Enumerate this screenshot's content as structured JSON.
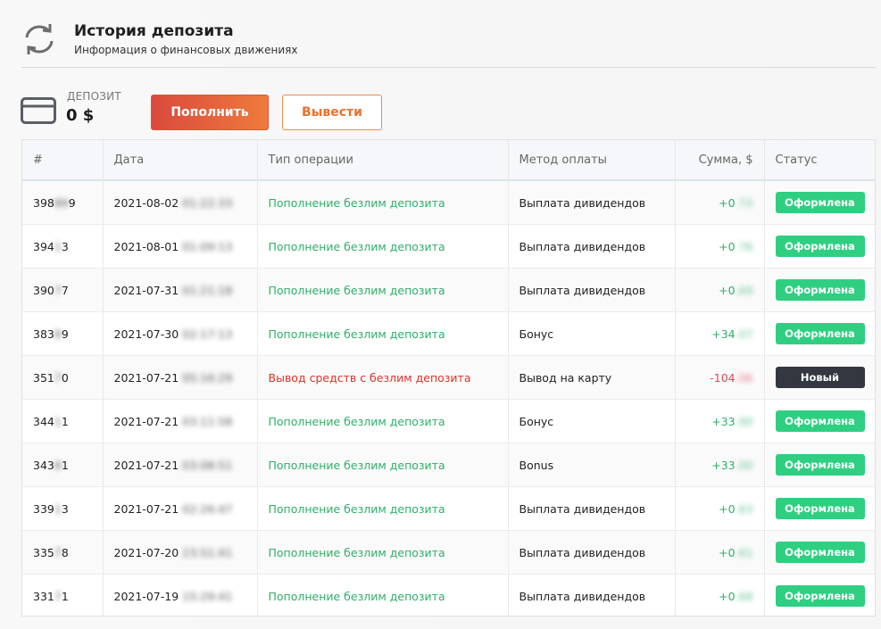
{
  "header": {
    "icon": "refresh-icon",
    "title": "История депозита",
    "subtitle": "Информация о финансовых движениях"
  },
  "deposit": {
    "icon": "credit-card-icon",
    "label": "ДЕПОЗИТ",
    "amount": "0 $",
    "topup_label": "Пополнить",
    "withdraw_label": "Вывести"
  },
  "colors": {
    "accent_gradient_start": "#d94a3d",
    "accent_gradient_end": "#ee7a3c",
    "positive": "#2eaf6a",
    "negative": "#d9342b",
    "badge_done": "#2fcf82",
    "badge_new": "#333840"
  },
  "table": {
    "columns": [
      "#",
      "Дата",
      "Тип операции",
      "Метод оплаты",
      "Сумма, $",
      "Статус"
    ],
    "rows": [
      {
        "id_a": "398",
        "id_b": "89",
        "id_c": "9",
        "date": "2021-08-02",
        "time": "01:22:33",
        "type": "Пополнение безлим депозита",
        "type_kind": "in",
        "method": "Выплата дивидендов",
        "amount_a": "+0",
        "amount_b": ".73",
        "sign": "pos",
        "status": "Оформлена",
        "status_kind": "done"
      },
      {
        "id_a": "394",
        "id_b": "1",
        "id_c": "3",
        "date": "2021-08-01",
        "time": "01:09:13",
        "type": "Пополнение безлим депозита",
        "type_kind": "in",
        "method": "Выплата дивидендов",
        "amount_a": "+0",
        "amount_b": ".76",
        "sign": "pos",
        "status": "Оформлена",
        "status_kind": "done"
      },
      {
        "id_a": "390",
        "id_b": "7",
        "id_c": "7",
        "date": "2021-07-31",
        "time": "01:21:18",
        "type": "Пополнение безлим депозита",
        "type_kind": "in",
        "method": "Выплата дивидендов",
        "amount_a": "+0",
        "amount_b": ".69",
        "sign": "pos",
        "status": "Оформлена",
        "status_kind": "done"
      },
      {
        "id_a": "383",
        "id_b": "8",
        "id_c": "9",
        "date": "2021-07-30",
        "time": "02:17:13",
        "type": "Пополнение безлим депозита",
        "type_kind": "in",
        "method": "Бонус",
        "amount_a": "+34",
        "amount_b": ".07",
        "sign": "pos",
        "status": "Оформлена",
        "status_kind": "done"
      },
      {
        "id_a": "351",
        "id_b": "7",
        "id_c": "0",
        "date": "2021-07-21",
        "time": "05:16:29",
        "type": "Вывод средств с безлим депозита",
        "type_kind": "out",
        "method": "Вывод на карту",
        "amount_a": "-104",
        "amount_b": ".06",
        "sign": "neg",
        "status": "Новый",
        "status_kind": "new"
      },
      {
        "id_a": "344",
        "id_b": "1",
        "id_c": "1",
        "date": "2021-07-21",
        "time": "03:11:58",
        "type": "Пополнение безлим депозита",
        "type_kind": "in",
        "method": "Бонус",
        "amount_a": "+33",
        "amount_b": ".00",
        "sign": "pos",
        "status": "Оформлена",
        "status_kind": "done"
      },
      {
        "id_a": "343",
        "id_b": "8",
        "id_c": "1",
        "date": "2021-07-21",
        "time": "03:08:51",
        "type": "Пополнение безлим депозита",
        "type_kind": "in",
        "method": "Bonus",
        "amount_a": "+33",
        "amount_b": ".00",
        "sign": "pos",
        "status": "Оформлена",
        "status_kind": "done"
      },
      {
        "id_a": "339",
        "id_b": "1",
        "id_c": "3",
        "date": "2021-07-21",
        "time": "02:26:47",
        "type": "Пополнение безлим депозита",
        "type_kind": "in",
        "method": "Выплата дивидендов",
        "amount_a": "+0",
        "amount_b": ".63",
        "sign": "pos",
        "status": "Оформлена",
        "status_kind": "done"
      },
      {
        "id_a": "335",
        "id_b": "7",
        "id_c": "8",
        "date": "2021-07-20",
        "time": "23:51:41",
        "type": "Пополнение безлим депозита",
        "type_kind": "in",
        "method": "Выплата дивидендов",
        "amount_a": "+0",
        "amount_b": ".61",
        "sign": "pos",
        "status": "Оформлена",
        "status_kind": "done"
      },
      {
        "id_a": "331",
        "id_b": "7",
        "id_c": "1",
        "date": "2021-07-19",
        "time": "15:29:41",
        "type": "Пополнение безлим депозита",
        "type_kind": "in",
        "method": "Выплата дивидендов",
        "amount_a": "+0",
        "amount_b": ".68",
        "sign": "pos",
        "status": "Оформлена",
        "status_kind": "done"
      }
    ]
  }
}
